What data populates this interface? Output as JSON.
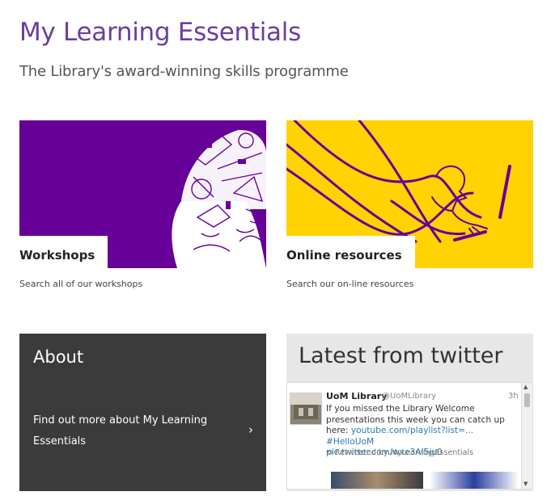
{
  "header": {
    "title": "My Learning Essentials",
    "subtitle": "The Library's award-winning skills programme"
  },
  "cards": [
    {
      "label": "Workshops",
      "caption": "Search all of our workshops"
    },
    {
      "label": "Online resources",
      "caption": "Search our on-line resources"
    }
  ],
  "about": {
    "title": "About",
    "link": "Find out more about My Learning Essentials",
    "chevron": "›"
  },
  "twitter": {
    "title": "Latest from twitter",
    "tweet": {
      "author": "UoM Library",
      "handle": "@UoMLibrary",
      "time": "3h",
      "text_1": "If you missed the Library Welcome presentations this week you can catch up here: ",
      "link_1": "youtube.com/playlist?list=...",
      "hashtag": "#HelloUoM",
      "link_2": "pic.twitter.com/wxe3AI5ju0",
      "retweet": "Retweeted by MyLearningEssentials"
    }
  },
  "colors": {
    "title": "#6b3ea0",
    "workshops_card": "#660099",
    "online_card": "#ffd200",
    "about_panel": "#3b3b3b",
    "link": "#2a7ab0"
  }
}
